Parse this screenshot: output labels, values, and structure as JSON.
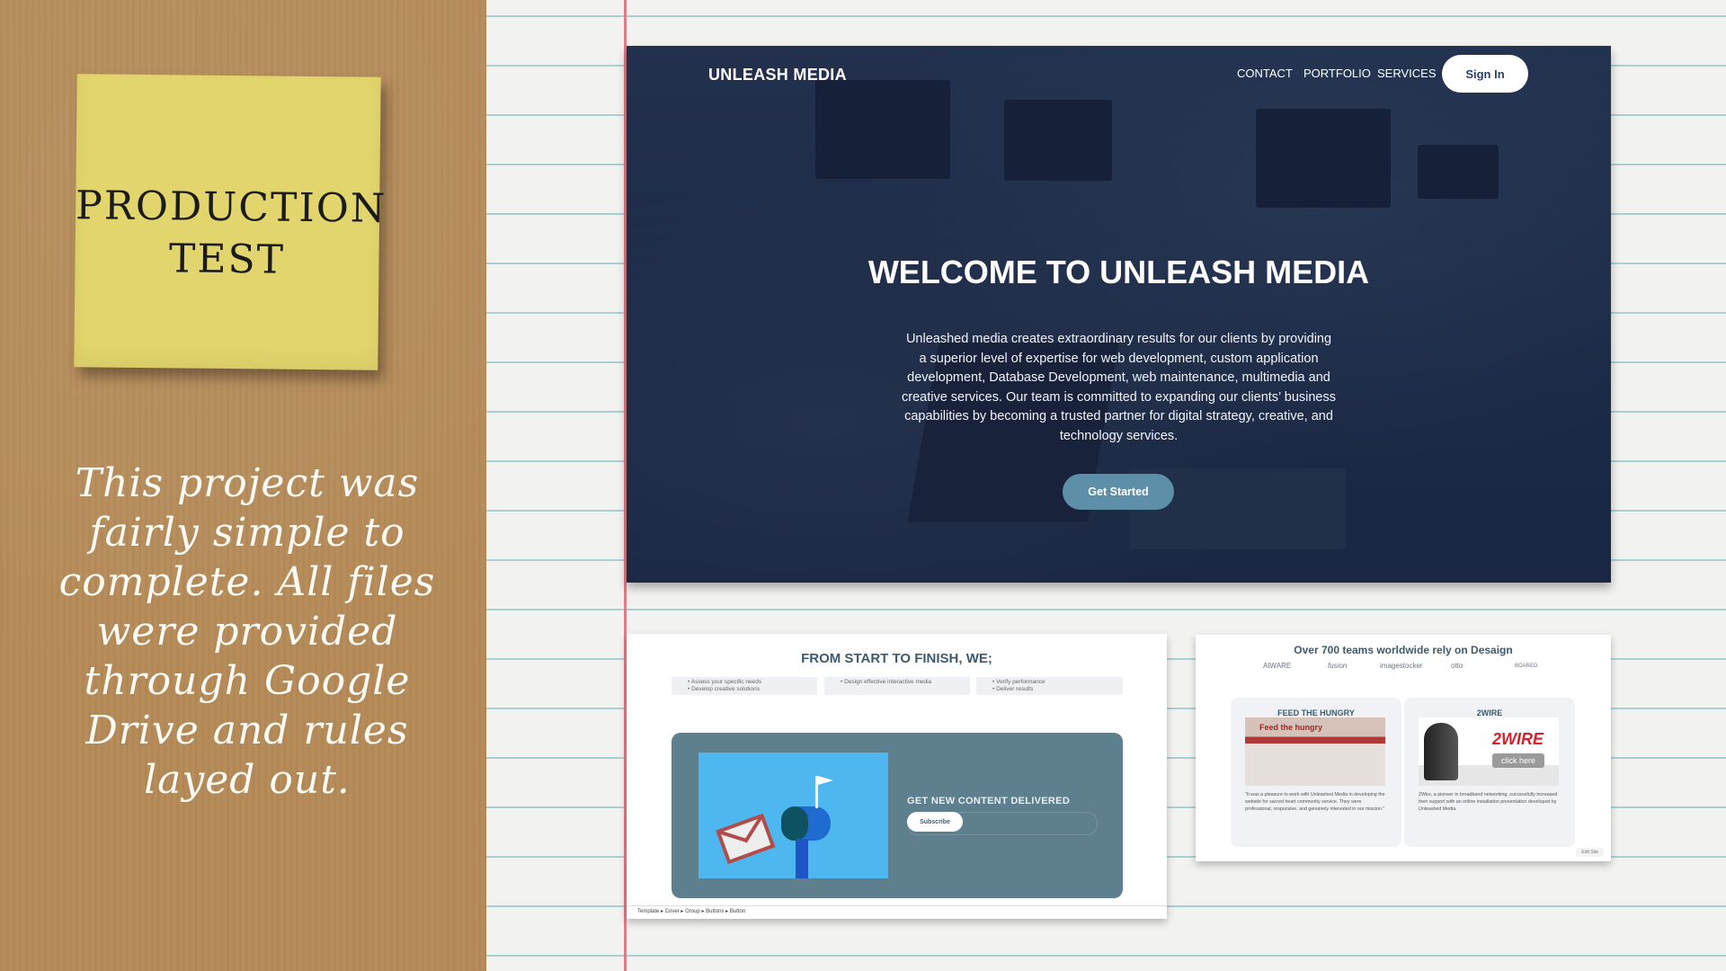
{
  "sticky_note": {
    "line1": "PRODUCTION",
    "line2": "TEST"
  },
  "note_text": "This project was fairly simple to complete. All files were provided through Google Drive and rules layed out.",
  "hero": {
    "brand": "UNLEASH MEDIA",
    "nav": [
      "CONTACT",
      "PORTFOLIO",
      "SERVICES"
    ],
    "signin": "Sign In",
    "title": "WELCOME TO UNLEASH MEDIA",
    "description": "Unleashed media creates extraordinary results for our clients by providing a superior level of expertise for web development, custom application development, Database Development, web maintenance, multimedia and creative services. Our team is committed to expanding our clients’ business capabilities by becoming a trusted partner for digital strategy, creative, and technology services.",
    "cta": "Get Started"
  },
  "steps_card": {
    "title": "FROM START TO FINISH, WE;",
    "steps": [
      [
        "Assess your specific needs",
        "Develop creative solutions"
      ],
      [
        "Design effective interactive media"
      ],
      [
        "Verify performance",
        "Deliver results"
      ]
    ],
    "subscribe_heading": "GET NEW CONTENT DELIVERED",
    "subscribe_button": "Subscribe",
    "breadcrumb": [
      "Template",
      "Cover",
      "Group",
      "Buttons",
      "Button"
    ]
  },
  "clients_card": {
    "title": "Over 700 teams worldwide rely on Desaign",
    "logos": [
      "AIWARE",
      "fusion",
      "imagestocker",
      "otto",
      "BOARED"
    ],
    "clients": [
      {
        "title": "FEED THE HUNGRY",
        "image_text": "Feed the hungry",
        "text": "\"It was a pleasure to work with Unleashed Media in developing the website for sacred heart community service. They were professional, responsive, and genuinely interested in our mission.\""
      },
      {
        "title": "2WIRE",
        "image_text": "2WIRE",
        "link_text": "click here",
        "text": "2Wire, a pioneer in broadband networking, successfully increased their support with an online installation presentation developed by Unleashed Media."
      }
    ],
    "edit_tag": "Edit Site"
  },
  "colors": {
    "cardboard": "#b58a57",
    "sticky": "#e2d56d",
    "margin_line": "#e07c86",
    "accent": "#3d5a6e"
  }
}
